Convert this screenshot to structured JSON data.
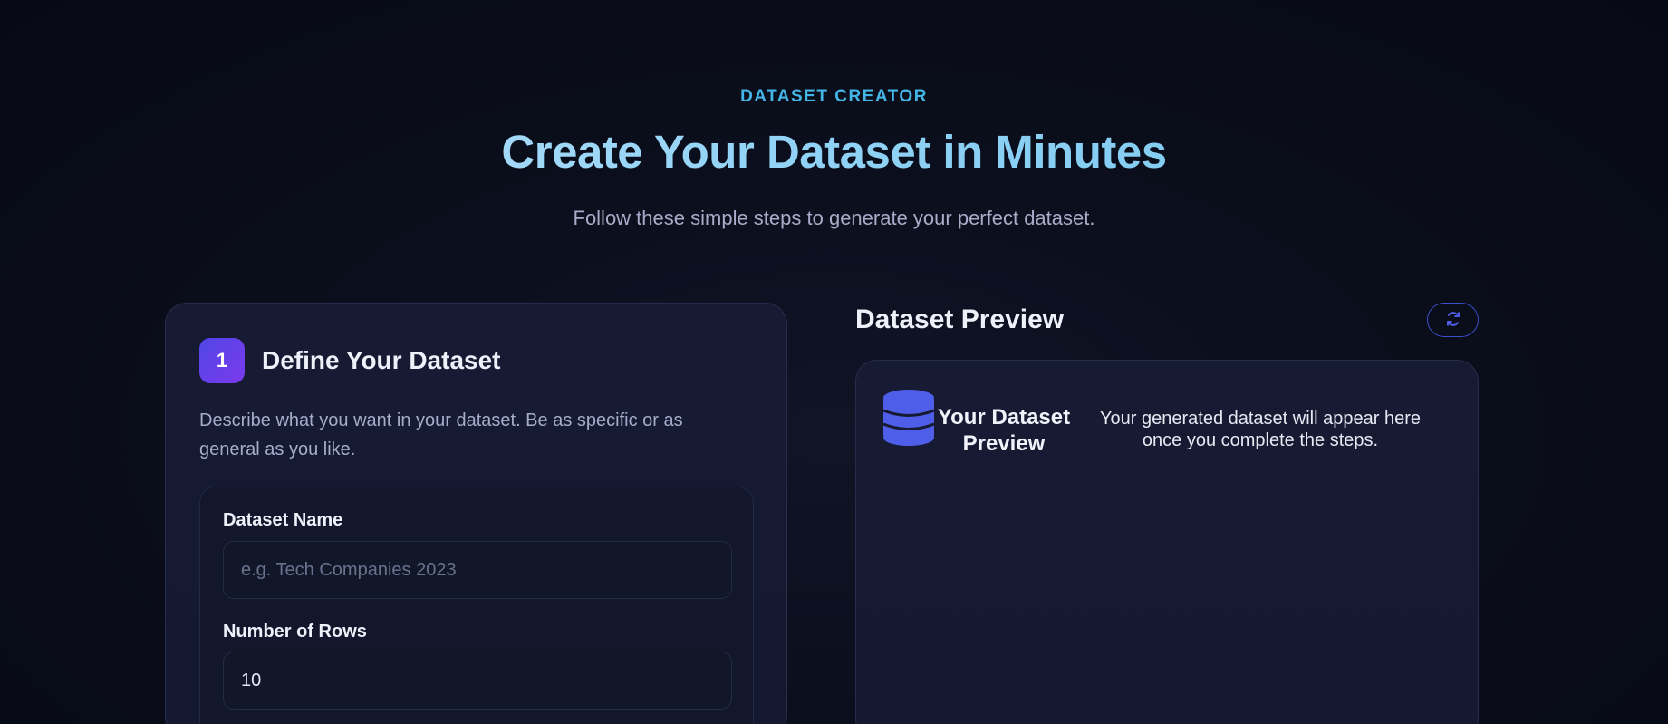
{
  "hero": {
    "eyebrow": "DATASET CREATOR",
    "title": "Create Your Dataset in Minutes",
    "subtitle": "Follow these simple steps to generate your perfect dataset."
  },
  "step1": {
    "number": "1",
    "title": "Define Your Dataset",
    "description": "Describe what you want in your dataset. Be as specific or as general as you like.",
    "fields": {
      "name_label": "Dataset Name",
      "name_placeholder": "e.g. Tech Companies 2023",
      "name_value": "",
      "rows_label": "Number of Rows",
      "rows_value": "10"
    }
  },
  "preview": {
    "title": "Dataset Preview",
    "refresh_icon": "refresh-icon",
    "empty_icon": "database-icon",
    "empty_heading": "Your Dataset Preview",
    "empty_message": "Your generated dataset will appear here once you complete the steps."
  },
  "colors": {
    "accent": "#43b5e6",
    "brand": "#4f5ee8",
    "badge_start": "#4f46e5",
    "badge_end": "#7c3aed"
  }
}
